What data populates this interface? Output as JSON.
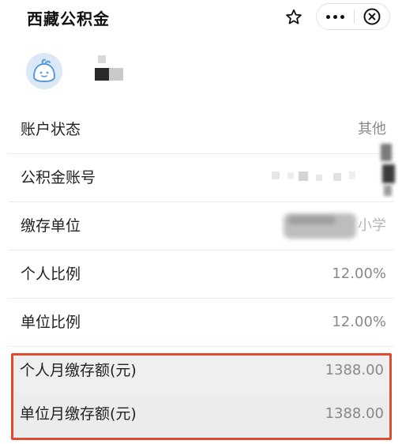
{
  "header": {
    "title": "西藏公积金",
    "favorite_icon": "star-icon",
    "more_icon": "more-dots-icon",
    "close_icon": "close-circle-icon"
  },
  "user": {
    "avatar_icon": "bun-avatar-icon"
  },
  "rows": [
    {
      "label": "账户状态",
      "value": "其他"
    },
    {
      "label": "公积金账号",
      "value": ""
    },
    {
      "label": "缴存单位",
      "value": "小学"
    },
    {
      "label": "个人比例",
      "value": "12.00%"
    },
    {
      "label": "单位比例",
      "value": "12.00%"
    },
    {
      "label": "个人月缴存额(元)",
      "value": "1388.00"
    },
    {
      "label": "单位月缴存额(元)",
      "value": "1388.00"
    }
  ],
  "colors": {
    "highlight_border": "#e2492f",
    "avatar_fill": "#dbe8f6",
    "avatar_stroke": "#5b9bd5"
  }
}
